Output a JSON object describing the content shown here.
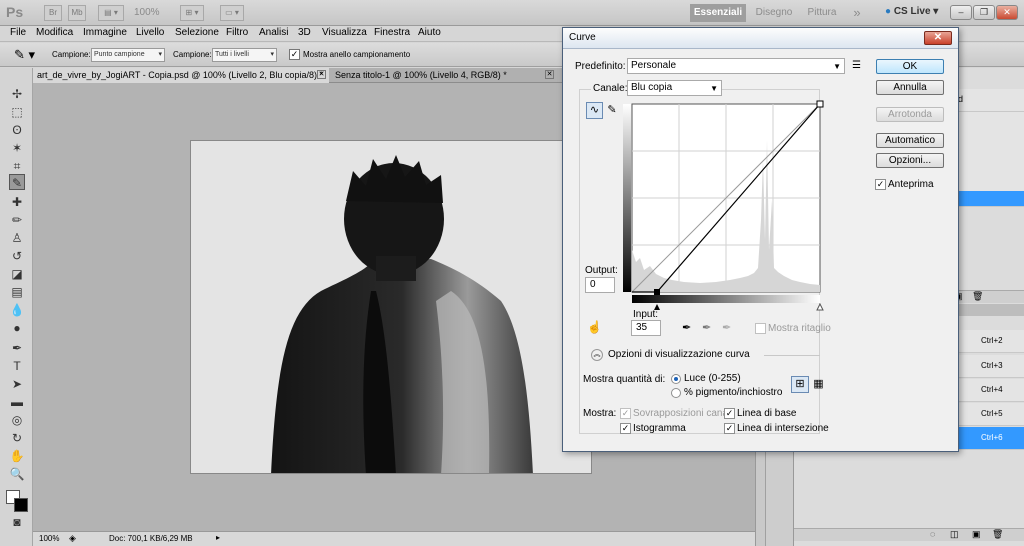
{
  "app": {
    "logo": "Ps",
    "zoom": "100%",
    "workspaces": [
      "Essenziali",
      "Disegno",
      "Pittura"
    ],
    "more": "»",
    "cs_live": "CS Live"
  },
  "menu": [
    "File",
    "Modifica",
    "Immagine",
    "Livello",
    "Selezione",
    "Filtro",
    "Analisi",
    "3D",
    "Visualizza",
    "Finestra",
    "Aiuto"
  ],
  "options": {
    "sample_label": "Campione:",
    "sample_value": "Punto campione",
    "sample2_label": "Campione:",
    "sample2_value": "Tutti i livelli",
    "ring_label": "Mostra anello campionamento"
  },
  "tabs": [
    {
      "label": "art_de_vivre_by_JogiART - Copia.psd @ 100% (Livello 2, Blu copia/8) *"
    },
    {
      "label": "Senza titolo-1 @ 100% (Livello 4, RGB/8) *"
    }
  ],
  "status": {
    "zoom": "100%",
    "doc": "Doc: 700,1 KB/6,29 MB"
  },
  "panels": {
    "shortcuts": [
      "Ctrl+2",
      "Ctrl+3",
      "Ctrl+4",
      "Ctrl+5",
      "Ctrl+6"
    ],
    "top_fragment": "d"
  },
  "dialog": {
    "title": "Curve",
    "preset_label": "Predefinito:",
    "preset_value": "Personale",
    "channel_label": "Canale:",
    "channel_value": "Blu copia",
    "output_label": "Output:",
    "output_value": "0",
    "input_label": "Input:",
    "input_value": "35",
    "clipping_label": "Mostra ritaglio",
    "display_options_label": "Opzioni di visualizzazione curva",
    "show_amount_label": "Mostra quantità di:",
    "light_label": "Luce (0-255)",
    "pigment_label": "% pigmento/inchiostro",
    "show_label": "Mostra:",
    "channel_overlays_label": "Sovrapposizioni canali",
    "baseline_label": "Linea di base",
    "histogram_label": "Istogramma",
    "intersection_label": "Linea di intersezione",
    "buttons": {
      "ok": "OK",
      "cancel": "Annulla",
      "smooth": "Arrotonda",
      "auto": "Automatico",
      "options": "Opzioni..."
    },
    "preview_label": "Anteprima"
  }
}
